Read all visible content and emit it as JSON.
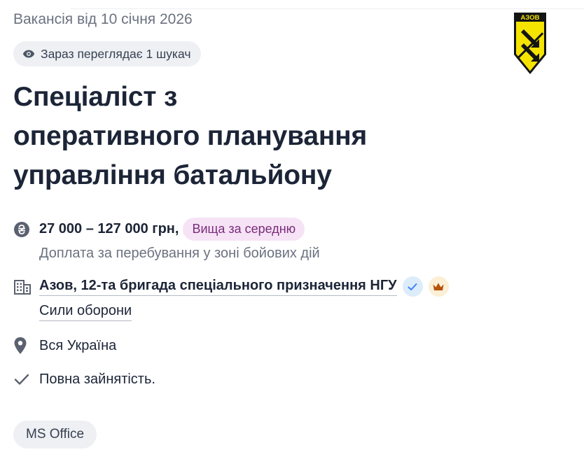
{
  "vacancy": {
    "posted": "Вакансія від 10 січня 2026",
    "viewers": "Зараз переглядає 1 шукач",
    "title_lines": [
      "Спеціаліст з",
      "оперативного планування",
      "управління батальйону"
    ],
    "salary": "27 000 – 127 000 грн,",
    "salary_badge": "Вища за середню",
    "bonus": "Доплата за перебування у зоні бойових дій",
    "company": "Азов, 12-та бригада спеціального призначення НГУ",
    "category": "Сили оборони",
    "location": "Вся Україна",
    "employment": "Повна зайнятість.",
    "skills": [
      "MS Office"
    ]
  },
  "logo": {
    "text": "АЗОВ",
    "colors": {
      "yellow": "#f5e400",
      "black": "#141414"
    }
  },
  "icons": {
    "viewers": "eye-icon",
    "salary": "hryvnia-icon",
    "company": "building-icon",
    "verified": "check-badge-icon",
    "premium": "crown-icon",
    "location": "map-pin-icon",
    "employment": "checkmark-icon"
  },
  "colors": {
    "title": "#1c2537",
    "muted": "#6b7280",
    "badge_bg": "#f6e3f6",
    "badge_text": "#7a2c7a",
    "verified": "#3b82f6",
    "premium": "#b45309"
  }
}
